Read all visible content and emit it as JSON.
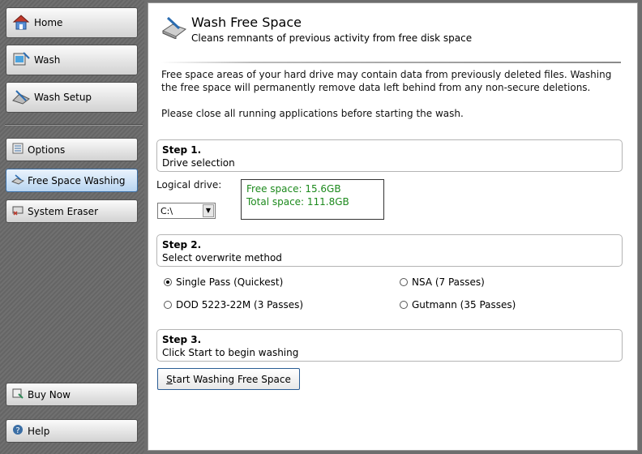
{
  "sidebar": {
    "items": [
      {
        "label": "Home",
        "icon": "home-icon"
      },
      {
        "label": "Wash",
        "icon": "wash-icon"
      },
      {
        "label": "Wash Setup",
        "icon": "wash-setup-icon"
      },
      {
        "label": "Options",
        "icon": "options-icon"
      },
      {
        "label": "Free Space Washing",
        "icon": "free-space-icon",
        "active": true
      },
      {
        "label": "System Eraser",
        "icon": "system-eraser-icon"
      },
      {
        "label": "Buy Now",
        "icon": "buy-now-icon"
      },
      {
        "label": "Help",
        "icon": "help-icon"
      }
    ]
  },
  "header": {
    "title": "Wash Free Space",
    "subtitle": "Cleans remnants of previous activity from free disk space",
    "icon": "wash-free-space-icon"
  },
  "intro": {
    "line1": "Free space areas of your hard drive may contain data from previously deleted files.  Washing",
    "line2": "the free space will permanently remove data left behind from any non-secure deletions.",
    "line3": "Please close all running applications before starting the wash."
  },
  "step1": {
    "heading": "Step 1.",
    "desc": "Drive selection",
    "drive_label": "Logical drive:",
    "drive_value": "C:\\",
    "free_space": "Free space: 15.6GB",
    "total_space": "Total space: 111.8GB"
  },
  "step2": {
    "heading": "Step 2.",
    "desc": "Select overwrite method",
    "options": [
      {
        "label": "Single Pass (Quickest)",
        "selected": true
      },
      {
        "label": "NSA (7 Passes)",
        "selected": false
      },
      {
        "label": "DOD 5223-22M (3 Passes)",
        "selected": false
      },
      {
        "label": "Gutmann (35 Passes)",
        "selected": false
      }
    ]
  },
  "step3": {
    "heading": "Step 3.",
    "desc": "Click Start to begin washing",
    "start_label_first": "S",
    "start_label_rest": "tart Washing Free Space"
  },
  "colors": {
    "accent": "#3a6ea5",
    "info_text": "#1d8a1d",
    "sidebar_bg": "#6e6e6e"
  }
}
